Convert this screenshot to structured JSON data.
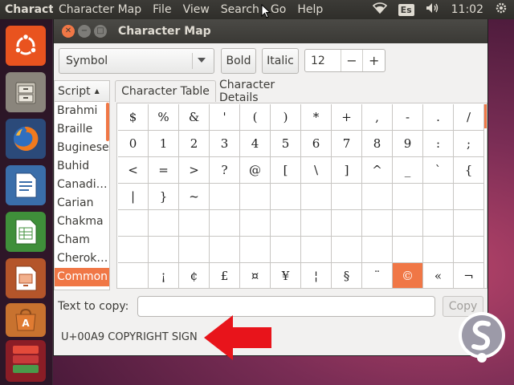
{
  "top_panel": {
    "app_title": "Characte",
    "menu": [
      "Character Map",
      "File",
      "View",
      "Search",
      "Go",
      "Help"
    ],
    "keyboard_layout": "Es",
    "clock": "11:02"
  },
  "launcher": {
    "items": [
      "ubuntu-dash-icon",
      "files-icon",
      "firefox-icon",
      "writer-icon",
      "calc-icon",
      "impress-icon",
      "software-center-icon",
      "trash-stack-icon"
    ]
  },
  "window": {
    "title": "Character Map",
    "toolbar": {
      "font": "Symbol",
      "bold_label": "Bold",
      "italic_label": "Italic",
      "font_size": "12",
      "decrease": "−",
      "increase": "+"
    },
    "script_list": {
      "header": "Script",
      "items": [
        "Brahmi",
        "Braille",
        "Buginese",
        "Buhid",
        "Canadi…",
        "Carian",
        "Chakma",
        "Cham",
        "Cherok…",
        "Common"
      ],
      "selected": "Common"
    },
    "tabs": [
      "Character Table",
      "Character Details"
    ],
    "char_table": {
      "rows": [
        [
          "$",
          "%",
          "&",
          "'",
          "(",
          ")",
          "*",
          "+",
          ",",
          "-",
          ".",
          "/"
        ],
        [
          "0",
          "1",
          "2",
          "3",
          "4",
          "5",
          "6",
          "7",
          "8",
          "9",
          ":",
          ";"
        ],
        [
          "<",
          "=",
          ">",
          "?",
          "@",
          "[",
          "\\",
          "]",
          "^",
          "_",
          "`",
          "{"
        ],
        [
          "|",
          "}",
          "~",
          "",
          "",
          "",
          "",
          "",
          "",
          "",
          "",
          ""
        ],
        [
          "",
          "",
          "",
          "",
          "",
          "",
          "",
          "",
          "",
          "",
          "",
          ""
        ],
        [
          "",
          "",
          "",
          "",
          "",
          "",
          "",
          "",
          "",
          "",
          "",
          ""
        ],
        [
          "",
          "¡",
          "¢",
          "£",
          "¤",
          "¥",
          "¦",
          "§",
          "¨",
          "©",
          "«",
          "¬"
        ]
      ],
      "selected": "©"
    },
    "copy": {
      "label": "Text to copy:",
      "value": "",
      "button": "Copy"
    },
    "status": "U+00A9 COPYRIGHT SIGN"
  },
  "colors": {
    "accent": "#f07746",
    "arrow": "#e8141b"
  }
}
